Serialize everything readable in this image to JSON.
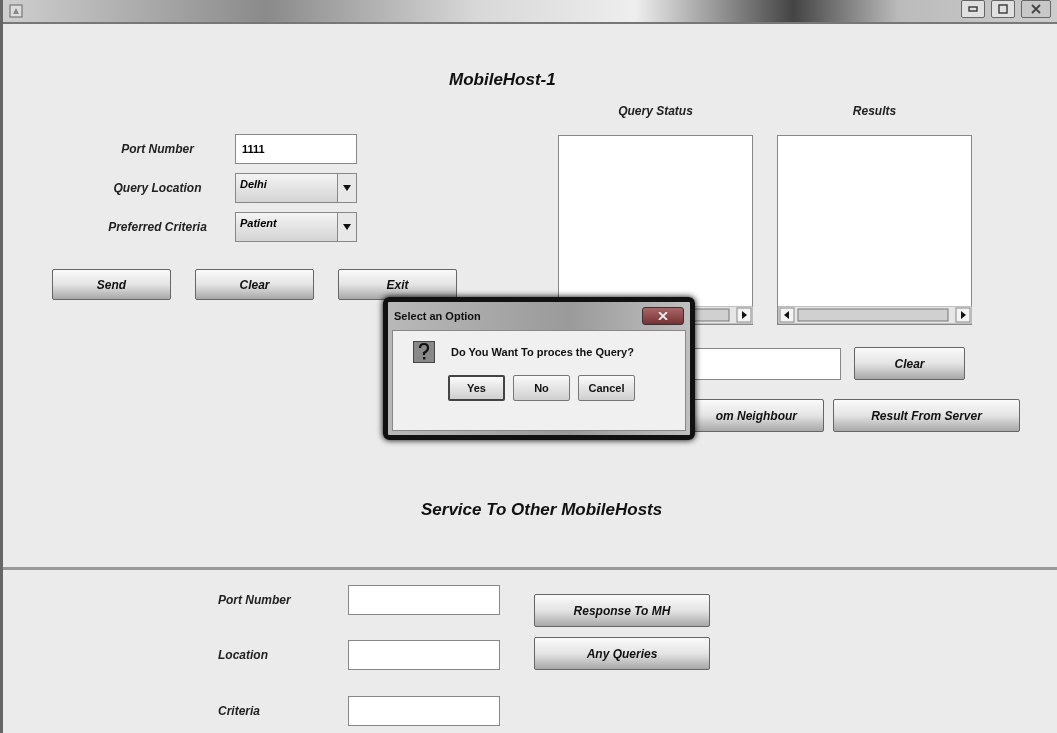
{
  "title": "MobileHost-1",
  "query_form": {
    "fields": [
      {
        "label": "Port Number",
        "kind": "text",
        "value": "1111"
      },
      {
        "label": "Query Location",
        "kind": "combo",
        "value": "Delhi"
      },
      {
        "label": "Preferred Criteria",
        "kind": "combo",
        "value": "Patient"
      }
    ],
    "buttons": [
      "Send",
      "Clear",
      "Exit"
    ]
  },
  "panels": [
    {
      "heading": "Query Status"
    },
    {
      "heading": "Results"
    }
  ],
  "message_row": {
    "button": "Clear"
  },
  "result_buttons": [
    "om Neighbour",
    "Result From Server"
  ],
  "service": {
    "heading": "Service To Other MobileHosts",
    "fields": [
      {
        "label": "Port Number"
      },
      {
        "label": "Location"
      },
      {
        "label": "Criteria"
      }
    ],
    "buttons": [
      "Response To MH",
      "Any Queries"
    ]
  },
  "dialog": {
    "title": "Select an Option",
    "message": "Do You Want To proces the Query?",
    "buttons": [
      {
        "label": "Yes",
        "selected": true
      },
      {
        "label": "No",
        "selected": false
      },
      {
        "label": "Cancel",
        "selected": false
      }
    ]
  }
}
